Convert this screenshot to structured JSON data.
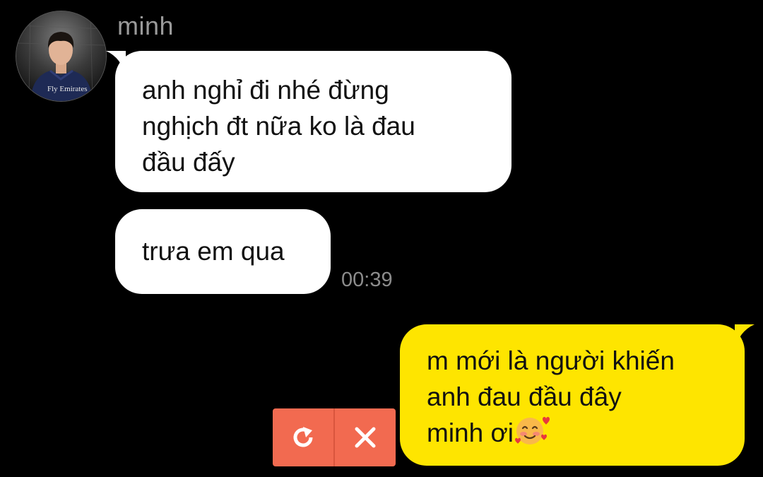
{
  "chat": {
    "partner_name": "minh",
    "avatar_print": "Fly Emirates",
    "messages_in": [
      {
        "lines": [
          "anh nghỉ đi nhé đừng",
          "nghịch đt nữa ko là đau",
          "đầu đấy"
        ]
      },
      {
        "lines": [
          "trưa em qua"
        ],
        "time": "00:39"
      }
    ],
    "message_out": {
      "lines": [
        "m mới là người khiến",
        "anh đau đầu đây",
        "minh ơi"
      ],
      "emoji": "smiling-face-with-hearts"
    },
    "send_failed_actions": {
      "retry_icon": "retry-icon",
      "delete_icon": "close-icon"
    }
  },
  "colors": {
    "background": "#000000",
    "incoming_bubble": "#ffffff",
    "outgoing_bubble": "#fee500",
    "failed_actions": "#f26a50",
    "name_text": "#9a9a9a",
    "time_text": "#8c8c8c"
  }
}
